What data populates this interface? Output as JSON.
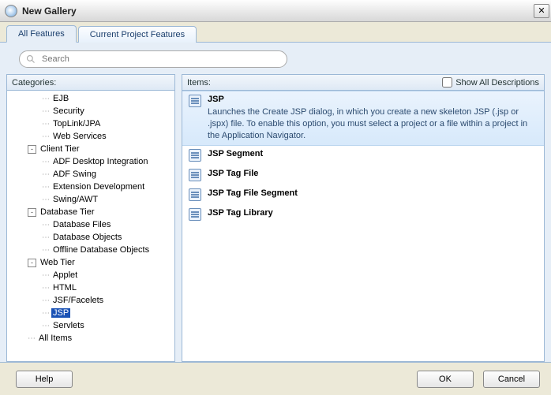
{
  "window": {
    "title": "New Gallery",
    "close": "✕"
  },
  "tabs": {
    "all": "All Features",
    "current": "Current Project Features"
  },
  "search": {
    "placeholder": "Search"
  },
  "categories": {
    "header": "Categories:",
    "tree": [
      {
        "depth": 2,
        "twisty": "",
        "label": "EJB",
        "truncated": true
      },
      {
        "depth": 2,
        "twisty": "",
        "label": "Security"
      },
      {
        "depth": 2,
        "twisty": "",
        "label": "TopLink/JPA"
      },
      {
        "depth": 2,
        "twisty": "",
        "label": "Web Services"
      },
      {
        "depth": 1,
        "twisty": "-",
        "label": "Client Tier"
      },
      {
        "depth": 2,
        "twisty": "",
        "label": "ADF Desktop Integration"
      },
      {
        "depth": 2,
        "twisty": "",
        "label": "ADF Swing"
      },
      {
        "depth": 2,
        "twisty": "",
        "label": "Extension Development"
      },
      {
        "depth": 2,
        "twisty": "",
        "label": "Swing/AWT"
      },
      {
        "depth": 1,
        "twisty": "-",
        "label": "Database Tier"
      },
      {
        "depth": 2,
        "twisty": "",
        "label": "Database Files"
      },
      {
        "depth": 2,
        "twisty": "",
        "label": "Database Objects"
      },
      {
        "depth": 2,
        "twisty": "",
        "label": "Offline Database Objects"
      },
      {
        "depth": 1,
        "twisty": "-",
        "label": "Web Tier"
      },
      {
        "depth": 2,
        "twisty": "",
        "label": "Applet"
      },
      {
        "depth": 2,
        "twisty": "",
        "label": "HTML"
      },
      {
        "depth": 2,
        "twisty": "",
        "label": "JSF/Facelets"
      },
      {
        "depth": 2,
        "twisty": "",
        "label": "JSP",
        "selected": true
      },
      {
        "depth": 2,
        "twisty": "",
        "label": "Servlets"
      },
      {
        "depth": 1,
        "twisty": "",
        "label": "All Items"
      }
    ]
  },
  "items": {
    "header": "Items:",
    "show_all_label": "Show All Descriptions",
    "show_all_checked": false,
    "list": [
      {
        "title": "JSP",
        "selected": true,
        "description": "Launches the Create JSP dialog, in which you create a new skeleton JSP (.jsp or .jspx) file. To enable this option, you must select a project or a file within a project in the Application Navigator."
      },
      {
        "title": "JSP Segment"
      },
      {
        "title": "JSP Tag File"
      },
      {
        "title": "JSP Tag File Segment"
      },
      {
        "title": "JSP Tag Library"
      }
    ]
  },
  "buttons": {
    "help": "Help",
    "ok": "OK",
    "cancel": "Cancel"
  }
}
